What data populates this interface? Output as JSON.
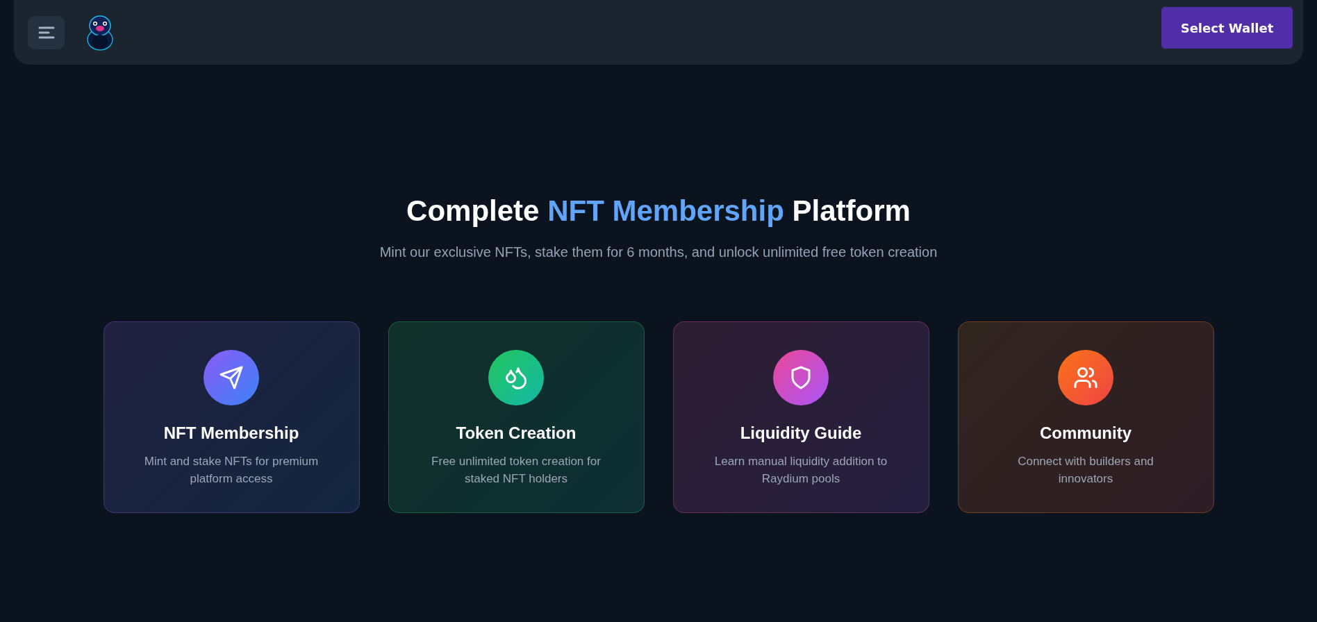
{
  "header": {
    "wallet_button": "Select Wallet"
  },
  "hero": {
    "title_parts": [
      {
        "text": "Complete ",
        "highlight": false
      },
      {
        "text": "NFT Membership",
        "highlight": true
      },
      {
        "text": " Platform",
        "highlight": false
      }
    ],
    "subtitle": "Mint our exclusive NFTs, stake them for 6 months, and unlock unlimited free token creation"
  },
  "features": [
    {
      "kind": "send",
      "title": "NFT Membership",
      "description": "Mint and stake NFTs for premium platform access"
    },
    {
      "kind": "droplets",
      "title": "Token Creation",
      "description": "Free unlimited token creation for staked NFT holders"
    },
    {
      "kind": "shield",
      "title": "Liquidity Guide",
      "description": "Learn manual liquidity addition to Raydium pools"
    },
    {
      "kind": "users",
      "title": "Community",
      "description": "Connect with builders and innovators"
    }
  ]
}
